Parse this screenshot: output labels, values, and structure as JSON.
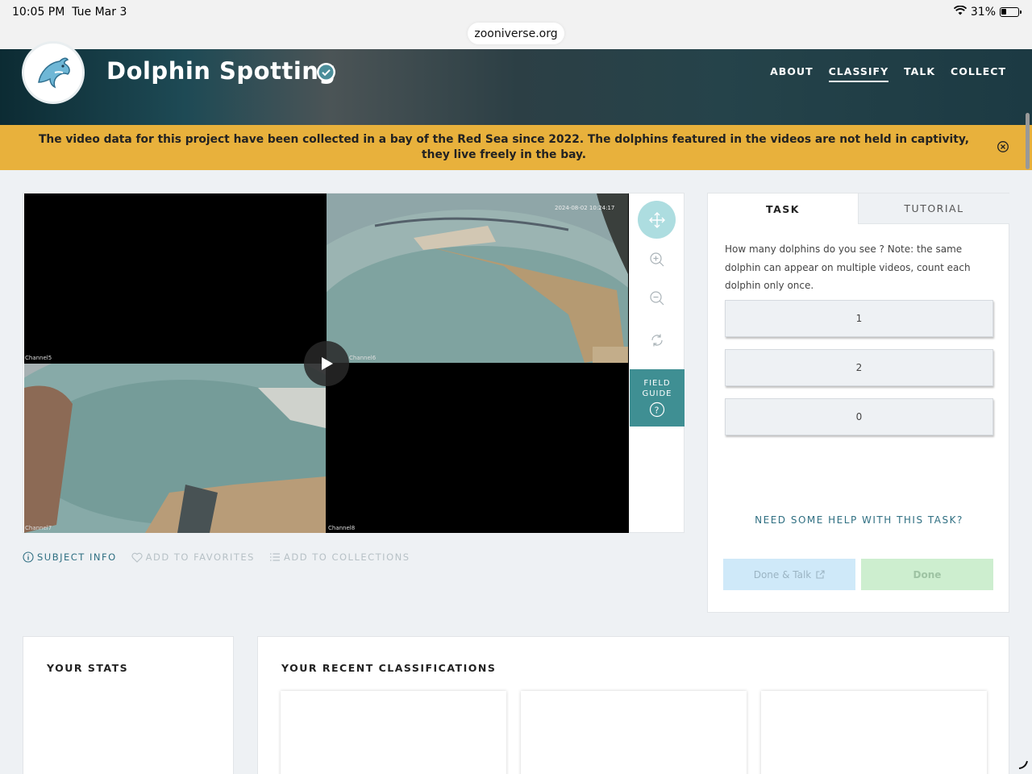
{
  "status_bar": {
    "time": "10:05 PM",
    "date": "Tue Mar 3",
    "battery": "31%",
    "url": "zooniverse.org"
  },
  "project": {
    "title": "Dolphin Spotting",
    "verified_icon": "check-circle-icon",
    "nav": [
      {
        "label": "ABOUT",
        "active": false
      },
      {
        "label": "CLASSIFY",
        "active": true
      },
      {
        "label": "TALK",
        "active": false
      },
      {
        "label": "COLLECT",
        "active": false
      }
    ]
  },
  "announcement": {
    "text": "The video data for this project have been collected in a bay of the Red Sea since 2022. The dolphins featured in the videos are not held in captivity, they live freely in the bay."
  },
  "viewer": {
    "timestamp": "2024-08-02 10:24:17",
    "channels": [
      "Channel5",
      "Channel6",
      "Channel7",
      "Channel8"
    ],
    "field_guide_label": "FIELD GUIDE",
    "meta": {
      "subject_info": "SUBJECT INFO",
      "add_favorites": "ADD TO FAVORITES",
      "add_collections": "ADD TO COLLECTIONS"
    }
  },
  "task": {
    "tabs": [
      "TASK",
      "TUTORIAL"
    ],
    "question": "How many dolphins do you see ? Note: the same dolphin can appear on multiple videos, count each dolphin only once.",
    "answers": [
      "1",
      "2",
      "0"
    ],
    "help": "NEED SOME HELP WITH THIS TASK?",
    "done_talk": "Done & Talk",
    "done": "Done"
  },
  "bottom": {
    "stats_title": "YOUR STATS",
    "recent_title": "YOUR RECENT CLASSIFICATIONS"
  },
  "colors": {
    "banner": "#e8b13c",
    "teal": "#3f8f93",
    "link": "#2f6f82"
  }
}
